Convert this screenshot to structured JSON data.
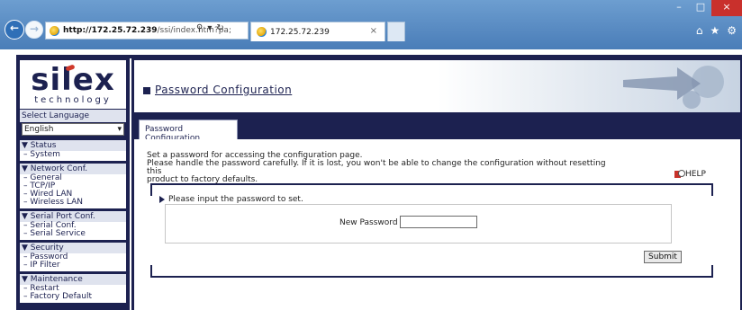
{
  "browser": {
    "url_host": "http://172.25.72.239",
    "url_path": "/ssi/index.htm?pa;",
    "tab_title": "172.25.72.239",
    "tab_close": "×",
    "win_minimize": "–",
    "win_maximize": "□",
    "win_close": "×",
    "back": "←",
    "forward": "→"
  },
  "sidebar": {
    "logo": "silex",
    "logo_sub": "technology",
    "select_language_label": "Select Language",
    "language_value": "English",
    "groups": [
      {
        "head": "▼ Status",
        "items": [
          "– System"
        ]
      },
      {
        "head": "▼ Network Conf.",
        "items": [
          "– General",
          "– TCP/IP",
          "– Wired LAN",
          "– Wireless LAN"
        ]
      },
      {
        "head": "▼ Serial Port Conf.",
        "items": [
          "– Serial Conf.",
          "– Serial Service"
        ]
      },
      {
        "head": "▼ Security",
        "items": [
          "– Password",
          "– IP Filter"
        ]
      },
      {
        "head": "▼ Maintenance",
        "items": [
          "– Restart",
          "– Factory Default"
        ]
      }
    ]
  },
  "main": {
    "title": "Password Configuration",
    "tab_label": "Password Configuration",
    "intro_line1": "Set a password for accessing the configuration page.",
    "intro_line2": "Please handle the password carefully. If it is lost, you won't be able to change the configuration without resetting this",
    "intro_line3": "product to factory defaults.",
    "help": "HELP",
    "prompt": "Please input the password to set.",
    "new_password_label": "New Password :",
    "new_password_value": "",
    "submit_label": "Submit"
  }
}
